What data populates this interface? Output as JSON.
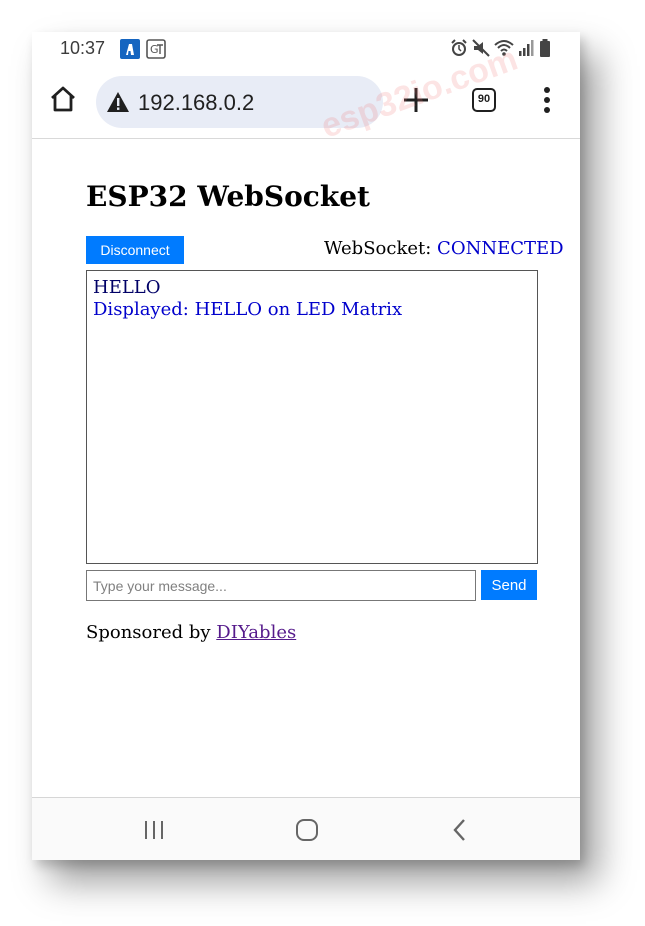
{
  "status_bar": {
    "time": "10:37"
  },
  "browser": {
    "url": "192.168.0.2",
    "tab_count": "90"
  },
  "watermark": "esp32io.com",
  "page": {
    "title": "ESP32 WebSocket",
    "disconnect_label": "Disconnect",
    "ws_label": "WebSocket: ",
    "ws_state": "CONNECTED",
    "messages": [
      {
        "text": "HELLO",
        "type": "sent"
      },
      {
        "text": "Displayed: HELLO on LED Matrix",
        "type": "received"
      }
    ],
    "input_placeholder": "Type your message...",
    "send_label": "Send",
    "sponsor_prefix": "Sponsored by ",
    "sponsor_link": "DIYables"
  },
  "colors": {
    "button_blue": "#007bff",
    "connected_blue": "#0000cc",
    "address_bar_bg": "#e8ecf6"
  }
}
